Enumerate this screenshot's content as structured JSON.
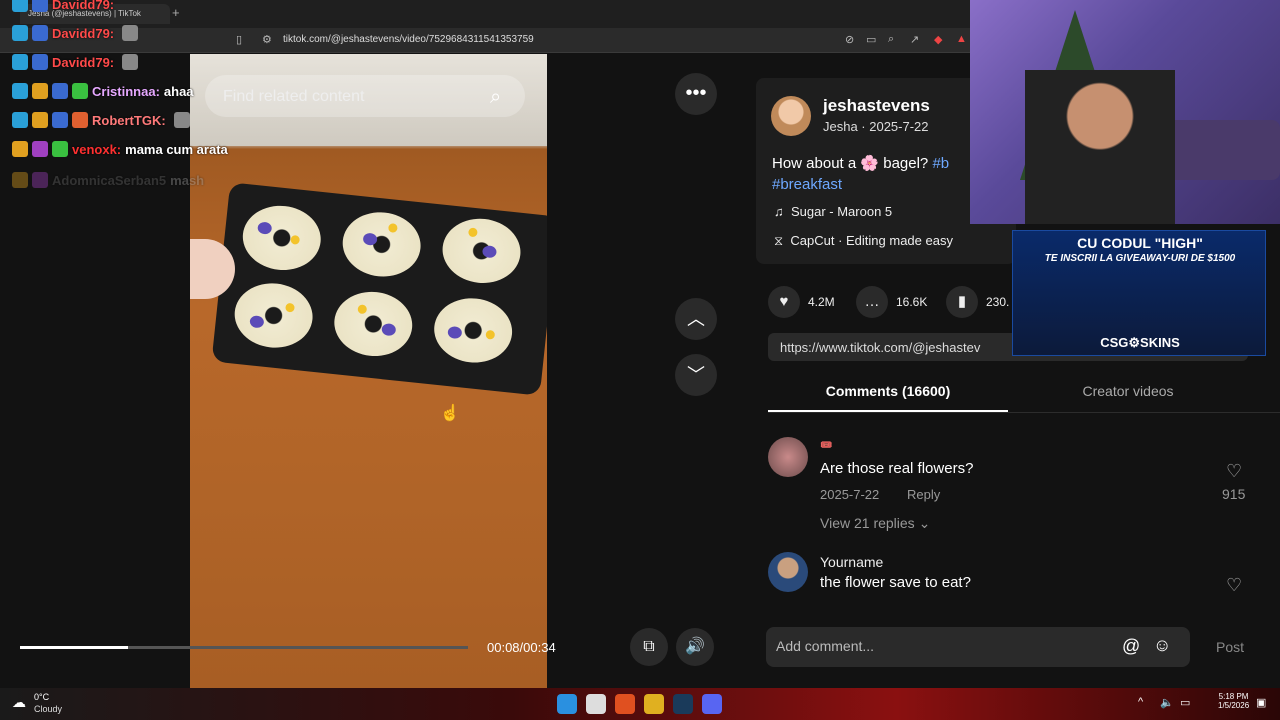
{
  "browser": {
    "tab_title": "Jesha (@jeshastevens) | TikTok",
    "new_tab": "+",
    "url": "tiktok.com/@jeshastevens/video/7529684311541353759"
  },
  "video": {
    "search_placeholder": "Find related content",
    "more": "•••",
    "time": "00:08/00:34",
    "progress": 0.24
  },
  "post": {
    "username": "jeshastevens",
    "subline": "Jesha · 2025-7-22",
    "description_prefix": "How about a 🌸 bagel?",
    "tag1": "#b",
    "tag2": "#breakfast",
    "music": "Sugar - Maroon 5",
    "capcut": "CapCut · Editing made easy",
    "likes": "4.2M",
    "comments_count": "16.6K",
    "saves": "230.",
    "link": "https://www.tiktok.com/@jeshastev"
  },
  "tabs": {
    "comments": "Comments (16600)",
    "creator": "Creator videos"
  },
  "comments": [
    {
      "name": "🎟️",
      "text": "Are those real flowers?",
      "date": "2025-7-22",
      "reply": "Reply",
      "likes": "915",
      "replies": "View 21 replies"
    },
    {
      "name": "Yourname",
      "text": "the flower save to eat?"
    }
  ],
  "compose": {
    "placeholder": "Add comment...",
    "post": "Post"
  },
  "chat": [
    {
      "user": "Davidd79:",
      "msg": "",
      "color": "#ff4a4a"
    },
    {
      "user": "Davidd79:",
      "msg": "",
      "color": "#ff4a4a"
    },
    {
      "user": "Davidd79:",
      "msg": "",
      "color": "#ff4a4a"
    },
    {
      "user": "Cristinnaa:",
      "msg": "ahaa",
      "color": "#e6a8ff"
    },
    {
      "user": "RobertTGK:",
      "msg": "",
      "color": "#ff7a7a"
    },
    {
      "user": "venoxk:",
      "msg": "mama cum arata",
      "color": "#ff3030"
    },
    {
      "user": "AdomnicaSerban5",
      "msg": "mash",
      "color": "#666666"
    }
  ],
  "promo": {
    "line1": "CU CODUL \"HIGH\"",
    "line2": "TE INSCRII LA GIVEAWAY-URI DE $1500",
    "line3": "CSG⚙SKINS"
  },
  "taskbar": {
    "temp": "0°C",
    "weather": "Cloudy",
    "clock_time": "5:18 PM",
    "clock_date": "1/5/2026"
  }
}
